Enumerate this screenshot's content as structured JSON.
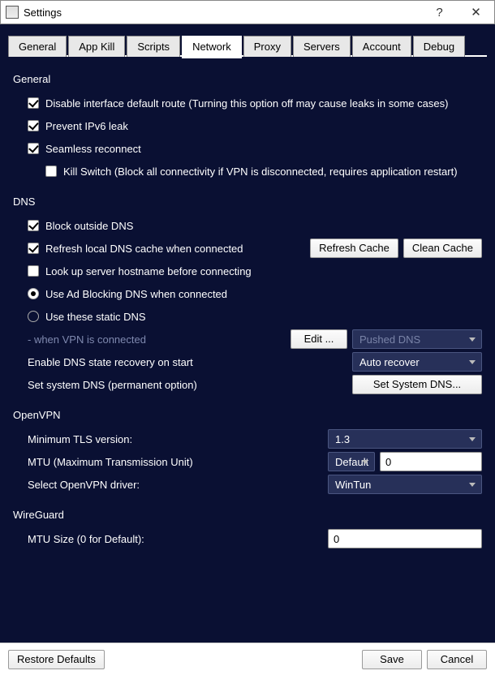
{
  "window": {
    "title": "Settings",
    "helpGlyph": "?",
    "closeGlyph": "✕"
  },
  "tabs": [
    {
      "label": "General"
    },
    {
      "label": "App Kill"
    },
    {
      "label": "Scripts"
    },
    {
      "label": "Network",
      "active": true
    },
    {
      "label": "Proxy"
    },
    {
      "label": "Servers"
    },
    {
      "label": "Account"
    },
    {
      "label": "Debug"
    }
  ],
  "sectionGeneral": {
    "title": "General",
    "disableDefaultRoute": {
      "label": "Disable interface default route (Turning this option off may cause leaks in some cases)",
      "checked": true
    },
    "preventIPv6": {
      "label": "Prevent IPv6 leak",
      "checked": true
    },
    "seamlessReconnect": {
      "label": "Seamless reconnect",
      "checked": true
    },
    "killSwitch": {
      "label": "Kill Switch (Block all connectivity if VPN is disconnected, requires application restart)",
      "checked": false
    }
  },
  "sectionDNS": {
    "title": "DNS",
    "blockOutside": {
      "label": "Block outside DNS",
      "checked": true
    },
    "refreshLocal": {
      "label": "Refresh local DNS cache when connected",
      "checked": true
    },
    "lookupHostname": {
      "label": "Look up server hostname before connecting",
      "checked": false
    },
    "dnsMode": {
      "adBlocking": {
        "label": "Use Ad Blocking DNS when connected",
        "selected": true
      },
      "staticDNS": {
        "label": "Use these static DNS",
        "selected": false
      }
    },
    "whenConnectedHint": "- when VPN is connected",
    "editBtn": "Edit ...",
    "dnsCombo": "Pushed DNS",
    "refreshCacheBtn": "Refresh Cache",
    "cleanCacheBtn": "Clean Cache",
    "stateRecoveryLabel": "Enable DNS state recovery on start",
    "stateRecoveryValue": "Auto recover",
    "setSystemDnsLabel": "Set system DNS (permanent option)",
    "setSystemDnsBtn": "Set System DNS..."
  },
  "sectionOpenVPN": {
    "title": "OpenVPN",
    "minTLSLabel": "Minimum TLS version:",
    "minTLSValue": "1.3",
    "mtuLabel": "MTU (Maximum Transmission Unit)",
    "mtuMode": "Default",
    "mtuValue": "0",
    "driverLabel": "Select OpenVPN driver:",
    "driverValue": "WinTun"
  },
  "sectionWireGuard": {
    "title": "WireGuard",
    "mtuLabel": "MTU Size (0 for Default):",
    "mtuValue": "0"
  },
  "footer": {
    "restore": "Restore Defaults",
    "save": "Save",
    "cancel": "Cancel"
  }
}
